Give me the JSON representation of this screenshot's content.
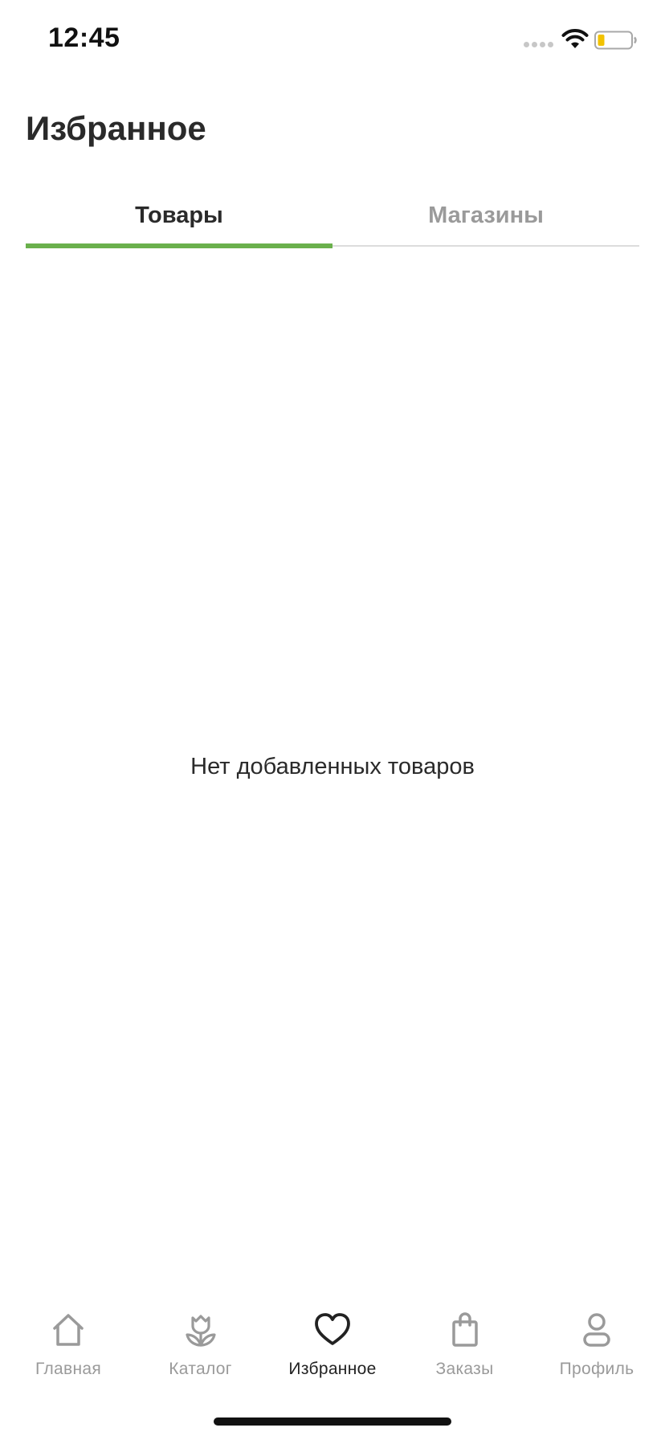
{
  "status_bar": {
    "time": "12:45"
  },
  "page": {
    "title": "Избранное"
  },
  "tabs": [
    {
      "label": "Товары",
      "active": true
    },
    {
      "label": "Магазины",
      "active": false
    }
  ],
  "empty_state": {
    "message": "Нет добавленных товаров"
  },
  "bottom_nav": {
    "items": [
      {
        "label": "Главная",
        "icon": "home-icon",
        "active": false
      },
      {
        "label": "Каталог",
        "icon": "tulip-icon",
        "active": false
      },
      {
        "label": "Избранное",
        "icon": "heart-icon",
        "active": true
      },
      {
        "label": "Заказы",
        "icon": "shopping-bag-icon",
        "active": false
      },
      {
        "label": "Профиль",
        "icon": "person-icon",
        "active": false
      }
    ]
  },
  "colors": {
    "accent": "#6ab04c",
    "text_primary": "#2a2a2a",
    "text_muted": "#9a9a9a",
    "battery_level": "#f2c200"
  }
}
